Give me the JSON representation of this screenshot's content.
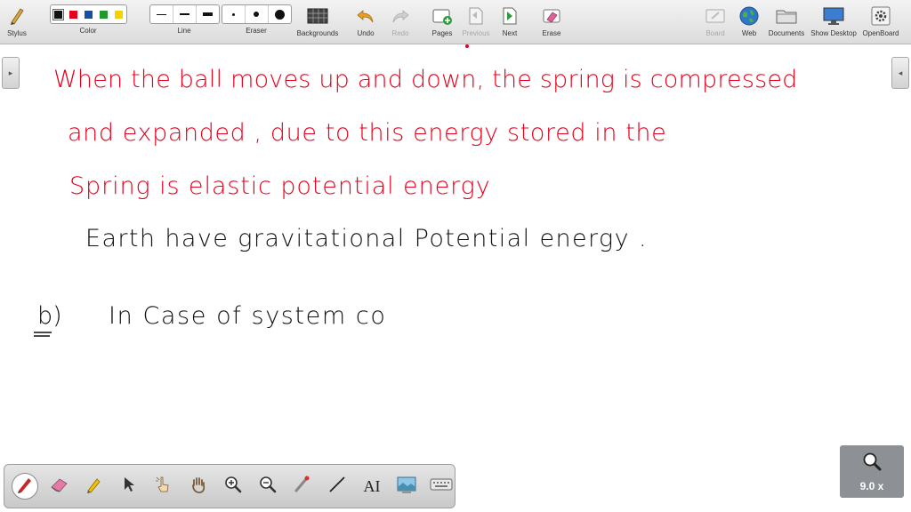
{
  "toolbar": {
    "stylus": "Stylus",
    "color": "Color",
    "line": "Line",
    "eraser": "Eraser",
    "backgrounds": "Backgrounds",
    "undo": "Undo",
    "redo": "Redo",
    "pages": "Pages",
    "previous": "Previous",
    "next": "Next",
    "erase": "Erase",
    "board": "Board",
    "web": "Web",
    "documents": "Documents",
    "show_desktop": "Show Desktop",
    "openboard": "OpenBoard"
  },
  "palette": [
    "#111111",
    "#e8001c",
    "#1a4f9a",
    "#1e9a2e",
    "#f2d300"
  ],
  "ink_red": "#e8001c",
  "ink_black": "#111111",
  "sidebar": {
    "left_tab": "▸",
    "right_tab": "◂"
  },
  "handwriting": {
    "line1": "When the ball moves up and down, the spring is compressed",
    "line2": "and expanded , due to this energy stored in the",
    "line3": "Spring is elastic potential energy",
    "line4": "Earth have gravitational Potential energy .",
    "line5_label": "b)",
    "line5": "In Case of system co"
  },
  "bottom_tools": [
    "pen-icon",
    "eraser-icon",
    "highlighter-icon",
    "pointer-icon",
    "hand-pointer-icon",
    "pan-hand-icon",
    "zoom-in-icon",
    "zoom-out-icon",
    "laser-pointer-icon",
    "line-icon",
    "text-icon",
    "capture-icon",
    "keyboard-icon"
  ],
  "bottom_text_tool": "AI",
  "zoom": {
    "level": "9.0 x"
  }
}
